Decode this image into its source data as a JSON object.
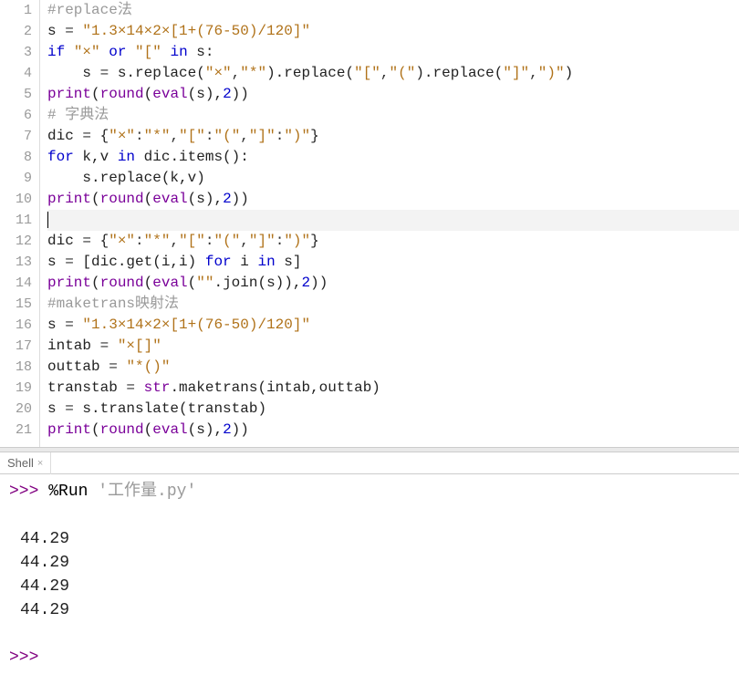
{
  "editor": {
    "lines": [
      {
        "num": 1,
        "tokens": [
          {
            "t": "#replace法",
            "c": "comment"
          }
        ]
      },
      {
        "num": 2,
        "tokens": [
          {
            "t": "s ",
            "c": "ident"
          },
          {
            "t": "=",
            "c": "punct"
          },
          {
            "t": " ",
            "c": "ident"
          },
          {
            "t": "\"1.3×14×2×[1+(76-50)/120]\"",
            "c": "string"
          }
        ]
      },
      {
        "num": 3,
        "tokens": [
          {
            "t": "if",
            "c": "keyword"
          },
          {
            "t": " ",
            "c": "ident"
          },
          {
            "t": "\"×\"",
            "c": "string"
          },
          {
            "t": " ",
            "c": "ident"
          },
          {
            "t": "or",
            "c": "keyword"
          },
          {
            "t": " ",
            "c": "ident"
          },
          {
            "t": "\"[\"",
            "c": "string"
          },
          {
            "t": " ",
            "c": "ident"
          },
          {
            "t": "in",
            "c": "keyword"
          },
          {
            "t": " s:",
            "c": "ident"
          }
        ]
      },
      {
        "num": 4,
        "tokens": [
          {
            "t": "    s ",
            "c": "ident"
          },
          {
            "t": "=",
            "c": "punct"
          },
          {
            "t": " s.replace(",
            "c": "ident"
          },
          {
            "t": "\"×\"",
            "c": "string"
          },
          {
            "t": ",",
            "c": "punct"
          },
          {
            "t": "\"*\"",
            "c": "string"
          },
          {
            "t": ").replace(",
            "c": "ident"
          },
          {
            "t": "\"[\"",
            "c": "string"
          },
          {
            "t": ",",
            "c": "punct"
          },
          {
            "t": "\"(\"",
            "c": "string"
          },
          {
            "t": ").replace(",
            "c": "ident"
          },
          {
            "t": "\"]\"",
            "c": "string"
          },
          {
            "t": ",",
            "c": "punct"
          },
          {
            "t": "\")\"",
            "c": "string"
          },
          {
            "t": ")",
            "c": "ident"
          }
        ]
      },
      {
        "num": 5,
        "tokens": [
          {
            "t": "print",
            "c": "builtin"
          },
          {
            "t": "(",
            "c": "ident"
          },
          {
            "t": "round",
            "c": "builtin"
          },
          {
            "t": "(",
            "c": "ident"
          },
          {
            "t": "eval",
            "c": "builtin"
          },
          {
            "t": "(s),",
            "c": "ident"
          },
          {
            "t": "2",
            "c": "number"
          },
          {
            "t": "))",
            "c": "ident"
          }
        ]
      },
      {
        "num": 6,
        "tokens": [
          {
            "t": "# 字典法",
            "c": "comment"
          }
        ]
      },
      {
        "num": 7,
        "tokens": [
          {
            "t": "dic ",
            "c": "ident"
          },
          {
            "t": "=",
            "c": "punct"
          },
          {
            "t": " {",
            "c": "ident"
          },
          {
            "t": "\"×\"",
            "c": "string"
          },
          {
            "t": ":",
            "c": "punct"
          },
          {
            "t": "\"*\"",
            "c": "string"
          },
          {
            "t": ",",
            "c": "punct"
          },
          {
            "t": "\"[\"",
            "c": "string"
          },
          {
            "t": ":",
            "c": "punct"
          },
          {
            "t": "\"(\"",
            "c": "string"
          },
          {
            "t": ",",
            "c": "punct"
          },
          {
            "t": "\"]\"",
            "c": "string"
          },
          {
            "t": ":",
            "c": "punct"
          },
          {
            "t": "\")\"",
            "c": "string"
          },
          {
            "t": "}",
            "c": "ident"
          }
        ]
      },
      {
        "num": 8,
        "tokens": [
          {
            "t": "for",
            "c": "keyword"
          },
          {
            "t": " k,v ",
            "c": "ident"
          },
          {
            "t": "in",
            "c": "keyword"
          },
          {
            "t": " dic.items():",
            "c": "ident"
          }
        ]
      },
      {
        "num": 9,
        "tokens": [
          {
            "t": "    s.replace(k,v)",
            "c": "ident"
          }
        ]
      },
      {
        "num": 10,
        "tokens": [
          {
            "t": "print",
            "c": "builtin"
          },
          {
            "t": "(",
            "c": "ident"
          },
          {
            "t": "round",
            "c": "builtin"
          },
          {
            "t": "(",
            "c": "ident"
          },
          {
            "t": "eval",
            "c": "builtin"
          },
          {
            "t": "(s),",
            "c": "ident"
          },
          {
            "t": "2",
            "c": "number"
          },
          {
            "t": "))",
            "c": "ident"
          }
        ]
      },
      {
        "num": 11,
        "active": true,
        "tokens": []
      },
      {
        "num": 12,
        "tokens": [
          {
            "t": "dic ",
            "c": "ident"
          },
          {
            "t": "=",
            "c": "punct"
          },
          {
            "t": " {",
            "c": "ident"
          },
          {
            "t": "\"×\"",
            "c": "string"
          },
          {
            "t": ":",
            "c": "punct"
          },
          {
            "t": "\"*\"",
            "c": "string"
          },
          {
            "t": ",",
            "c": "punct"
          },
          {
            "t": "\"[\"",
            "c": "string"
          },
          {
            "t": ":",
            "c": "punct"
          },
          {
            "t": "\"(\"",
            "c": "string"
          },
          {
            "t": ",",
            "c": "punct"
          },
          {
            "t": "\"]\"",
            "c": "string"
          },
          {
            "t": ":",
            "c": "punct"
          },
          {
            "t": "\")\"",
            "c": "string"
          },
          {
            "t": "}",
            "c": "ident"
          }
        ]
      },
      {
        "num": 13,
        "tokens": [
          {
            "t": "s ",
            "c": "ident"
          },
          {
            "t": "=",
            "c": "punct"
          },
          {
            "t": " [dic.get(i,i) ",
            "c": "ident"
          },
          {
            "t": "for",
            "c": "keyword"
          },
          {
            "t": " i ",
            "c": "ident"
          },
          {
            "t": "in",
            "c": "keyword"
          },
          {
            "t": " s]",
            "c": "ident"
          }
        ]
      },
      {
        "num": 14,
        "tokens": [
          {
            "t": "print",
            "c": "builtin"
          },
          {
            "t": "(",
            "c": "ident"
          },
          {
            "t": "round",
            "c": "builtin"
          },
          {
            "t": "(",
            "c": "ident"
          },
          {
            "t": "eval",
            "c": "builtin"
          },
          {
            "t": "(",
            "c": "ident"
          },
          {
            "t": "\"\"",
            "c": "string"
          },
          {
            "t": ".join(s)),",
            "c": "ident"
          },
          {
            "t": "2",
            "c": "number"
          },
          {
            "t": "))",
            "c": "ident"
          }
        ]
      },
      {
        "num": 15,
        "tokens": [
          {
            "t": "#maketrans映射法",
            "c": "comment"
          }
        ]
      },
      {
        "num": 16,
        "tokens": [
          {
            "t": "s ",
            "c": "ident"
          },
          {
            "t": "=",
            "c": "punct"
          },
          {
            "t": " ",
            "c": "ident"
          },
          {
            "t": "\"1.3×14×2×[1+(76-50)/120]\"",
            "c": "string"
          }
        ]
      },
      {
        "num": 17,
        "tokens": [
          {
            "t": "intab ",
            "c": "ident"
          },
          {
            "t": "=",
            "c": "punct"
          },
          {
            "t": " ",
            "c": "ident"
          },
          {
            "t": "\"×[]\"",
            "c": "string"
          }
        ]
      },
      {
        "num": 18,
        "tokens": [
          {
            "t": "outtab ",
            "c": "ident"
          },
          {
            "t": "=",
            "c": "punct"
          },
          {
            "t": " ",
            "c": "ident"
          },
          {
            "t": "\"*()\"",
            "c": "string"
          }
        ]
      },
      {
        "num": 19,
        "tokens": [
          {
            "t": "transtab ",
            "c": "ident"
          },
          {
            "t": "=",
            "c": "punct"
          },
          {
            "t": " ",
            "c": "ident"
          },
          {
            "t": "str",
            "c": "builtin"
          },
          {
            "t": ".maketrans(intab,outtab)",
            "c": "ident"
          }
        ]
      },
      {
        "num": 20,
        "tokens": [
          {
            "t": "s ",
            "c": "ident"
          },
          {
            "t": "=",
            "c": "punct"
          },
          {
            "t": " s.translate(transtab)",
            "c": "ident"
          }
        ]
      },
      {
        "num": 21,
        "tokens": [
          {
            "t": "print",
            "c": "builtin"
          },
          {
            "t": "(",
            "c": "ident"
          },
          {
            "t": "round",
            "c": "builtin"
          },
          {
            "t": "(",
            "c": "ident"
          },
          {
            "t": "eval",
            "c": "builtin"
          },
          {
            "t": "(s),",
            "c": "ident"
          },
          {
            "t": "2",
            "c": "number"
          },
          {
            "t": "))",
            "c": "ident"
          }
        ]
      }
    ]
  },
  "shell": {
    "tab_label": "Shell",
    "close_glyph": "×",
    "prompt": ">>>",
    "run_cmd": "%Run ",
    "run_arg": "'工作量.py'",
    "output": [
      "44.29",
      "44.29",
      "44.29",
      "44.29"
    ]
  }
}
